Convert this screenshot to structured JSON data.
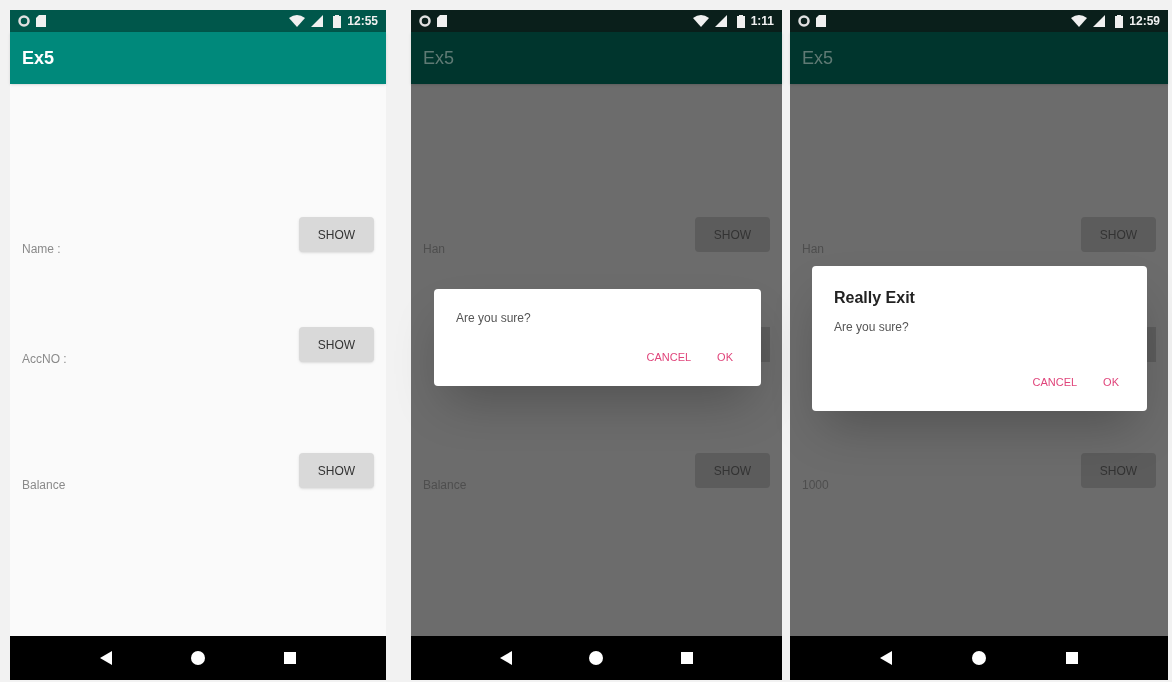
{
  "phones": [
    {
      "status_bar": {
        "time": "12:55"
      },
      "app_bar": {
        "title": "Ex5"
      },
      "dimmed": false,
      "rows": [
        {
          "label": "Name :",
          "button": "SHOW"
        },
        {
          "label": "AccNO :",
          "button": "SHOW"
        },
        {
          "label": "Balance",
          "button": "SHOW"
        }
      ]
    },
    {
      "status_bar": {
        "time": "1:11"
      },
      "app_bar": {
        "title": "Ex5"
      },
      "dimmed": true,
      "rows": [
        {
          "label": "Han",
          "button": "SHOW"
        },
        {
          "covered": true
        },
        {
          "label": "Balance",
          "button": "SHOW"
        }
      ],
      "dialog": {
        "message": "Are you sure?",
        "buttons": [
          "CANCEL",
          "OK"
        ]
      }
    },
    {
      "status_bar": {
        "time": "12:59"
      },
      "app_bar": {
        "title": "Ex5"
      },
      "dimmed": true,
      "rows": [
        {
          "label": "Han",
          "button": "SHOW"
        },
        {
          "covered": true
        },
        {
          "label": "1000",
          "button": "SHOW"
        }
      ],
      "dialog": {
        "title": "Really Exit",
        "message": "Are you sure?",
        "buttons": [
          "CANCEL",
          "OK"
        ]
      }
    }
  ]
}
